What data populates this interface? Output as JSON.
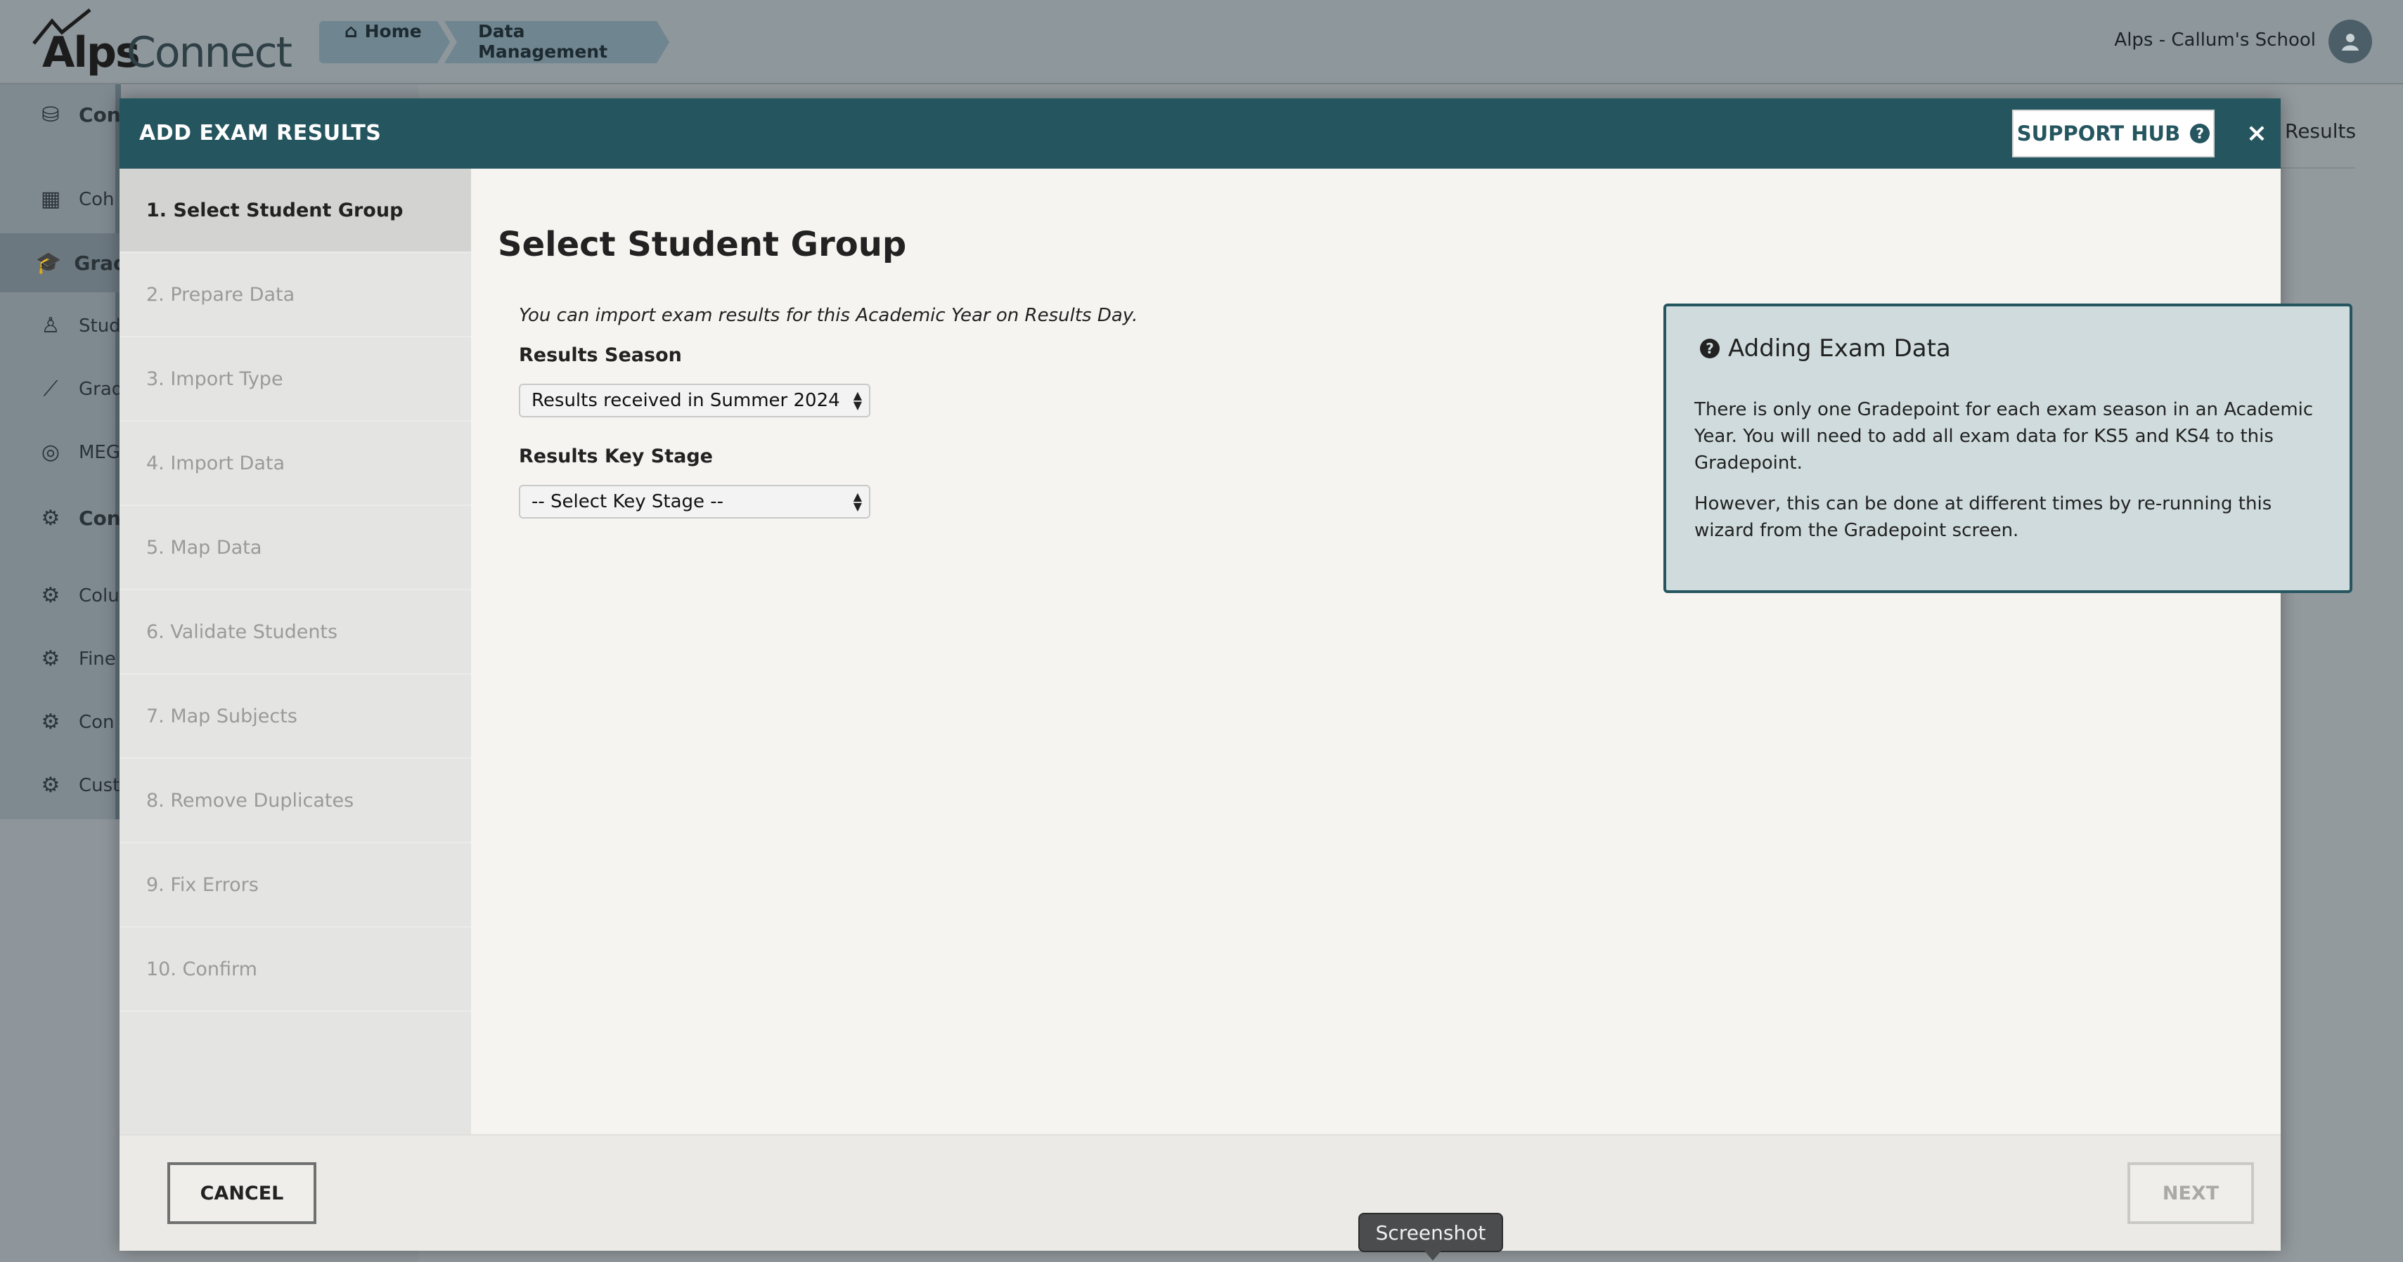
{
  "app": {
    "logo_alps": "Alps",
    "logo_connect": "Connect",
    "user": "Alps - Callum's School"
  },
  "breadcrumb": {
    "home": "Home",
    "current": "Data Management"
  },
  "bg_sidebar": {
    "items": [
      {
        "label": "Con",
        "icon": "database-icon"
      },
      {
        "label": "Coh",
        "icon": "table-icon"
      },
      {
        "label": "Grad",
        "icon": "graduation-cap-icon"
      },
      {
        "label": "Stud",
        "icon": "student-icon"
      },
      {
        "label": "Grad",
        "icon": "line-chart-icon"
      },
      {
        "label": "MEG",
        "icon": "target-icon"
      },
      {
        "label": "Con",
        "icon": "gear-icon"
      },
      {
        "label": "Colu",
        "icon": "gear-icon"
      },
      {
        "label": "Fine",
        "icon": "gear-icon"
      },
      {
        "label": "Con",
        "icon": "gear-icon"
      },
      {
        "label": "Cust",
        "icon": "gear-icon"
      }
    ]
  },
  "bg_right_label": "Results",
  "modal": {
    "title": "ADD EXAM RESULTS",
    "support_label": "SUPPORT HUB",
    "close_label": "×",
    "steps": [
      "1. Select Student Group",
      "2. Prepare Data",
      "3. Import Type",
      "4. Import Data",
      "5. Map Data",
      "6. Validate Students",
      "7. Map Subjects",
      "8. Remove Duplicates",
      "9. Fix Errors",
      "10. Confirm"
    ],
    "active_step": 0,
    "heading": "Select Student Group",
    "note": "You can import exam results for this Academic Year on Results Day.",
    "season_label": "Results Season",
    "season_value": "Results received in Summer 2024",
    "keystage_label": "Results Key Stage",
    "keystage_value": "-- Select Key Stage --",
    "info": {
      "title": "Adding Exam Data",
      "p1": "There is only one Gradepoint for each exam season in an Academic Year. You will need to add all exam data for KS5 and KS4 to this Gradepoint.",
      "p2": "However, this can be done at different times by re-running this wizard from the Gradepoint screen."
    },
    "cancel_label": "CANCEL",
    "next_label": "NEXT"
  },
  "tooltip": "Screenshot",
  "colors": {
    "header": "#25555f",
    "info_bg": "#cfdbdc"
  }
}
